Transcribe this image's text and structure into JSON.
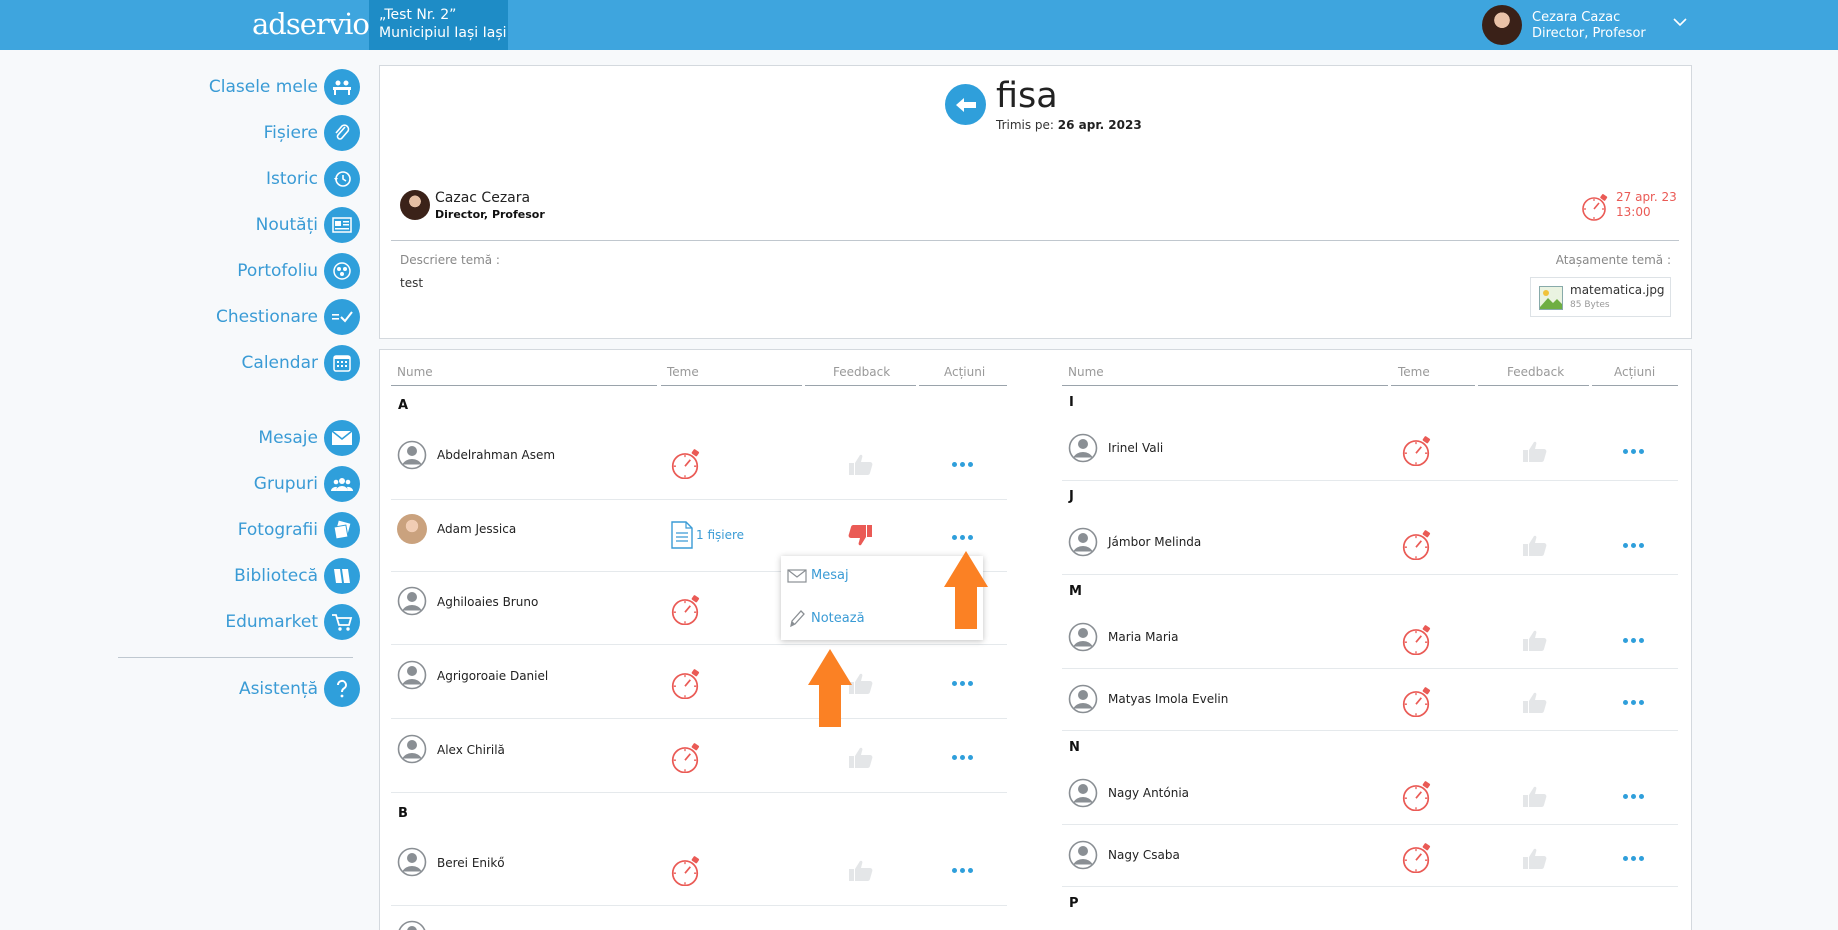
{
  "header": {
    "logo": "adservio",
    "school_line1": "„Test Nr. 2”",
    "school_line2": "Municipiul Iași Iași",
    "user_name": "Cezara Cazac",
    "user_role": "Director, Profesor"
  },
  "sidebar": {
    "items": [
      {
        "label": "Clasele mele",
        "icon": "classes-icon"
      },
      {
        "label": "Fișiere",
        "icon": "paperclip-icon"
      },
      {
        "label": "Istoric",
        "icon": "history-icon"
      },
      {
        "label": "Noutăți",
        "icon": "news-icon"
      },
      {
        "label": "Portofoliu",
        "icon": "portfolio-icon"
      },
      {
        "label": "Chestionare",
        "icon": "questionnaire-icon"
      },
      {
        "label": "Calendar",
        "icon": "calendar-icon"
      },
      {
        "label": "Mesaje",
        "icon": "envelope-icon"
      },
      {
        "label": "Grupuri",
        "icon": "groups-icon"
      },
      {
        "label": "Fotografii",
        "icon": "photos-icon"
      },
      {
        "label": "Bibliotecă",
        "icon": "library-icon"
      },
      {
        "label": "Edumarket",
        "icon": "cart-icon"
      },
      {
        "label": "Asistență",
        "icon": "help-icon"
      }
    ]
  },
  "assignment": {
    "title": "fisa",
    "sent_label": "Trimis pe:",
    "sent_date": "26 apr. 2023",
    "author_name": "Cazac Cezara",
    "author_role": "Director, Profesor",
    "deadline_date": "27 apr. 23",
    "deadline_time": "13:00",
    "description_label": "Descriere temă :",
    "description": "test",
    "attachments_label": "Atașamente temă :",
    "attachment_name": "matematica.jpg",
    "attachment_size": "85 Bytes"
  },
  "table": {
    "headers": [
      "Nume",
      "Teme",
      "Feedback",
      "Acțiuni"
    ],
    "left": [
      {
        "letter": "A"
      },
      {
        "name": "Abdelrahman Asem"
      },
      {
        "name": "Adam Jessica",
        "files": "1 fișiere",
        "feedback": "dislike"
      },
      {
        "name": "Aghiloaies Bruno"
      },
      {
        "name": "Agrigoroaie Daniel"
      },
      {
        "name": "Alex Chirilă"
      },
      {
        "letter": "B"
      },
      {
        "name": "Berei Enikő"
      }
    ],
    "right": [
      {
        "letter": "I"
      },
      {
        "name": "Irinel Vali"
      },
      {
        "letter": "J"
      },
      {
        "name": "Jámbor Melinda"
      },
      {
        "letter": "M"
      },
      {
        "name": "Maria Maria"
      },
      {
        "name": "Matyas Imola Evelin"
      },
      {
        "letter": "N"
      },
      {
        "name": "Nagy Antónia"
      },
      {
        "name": "Nagy Csaba"
      },
      {
        "letter": "P"
      }
    ]
  },
  "context_menu": {
    "message": "Mesaj",
    "grade": "Notează"
  },
  "colors": {
    "topbar": "#3ea5de",
    "accent": "#2f9fdb",
    "deadline": "#ea5a55",
    "highlight_arrow": "#fb8124"
  }
}
